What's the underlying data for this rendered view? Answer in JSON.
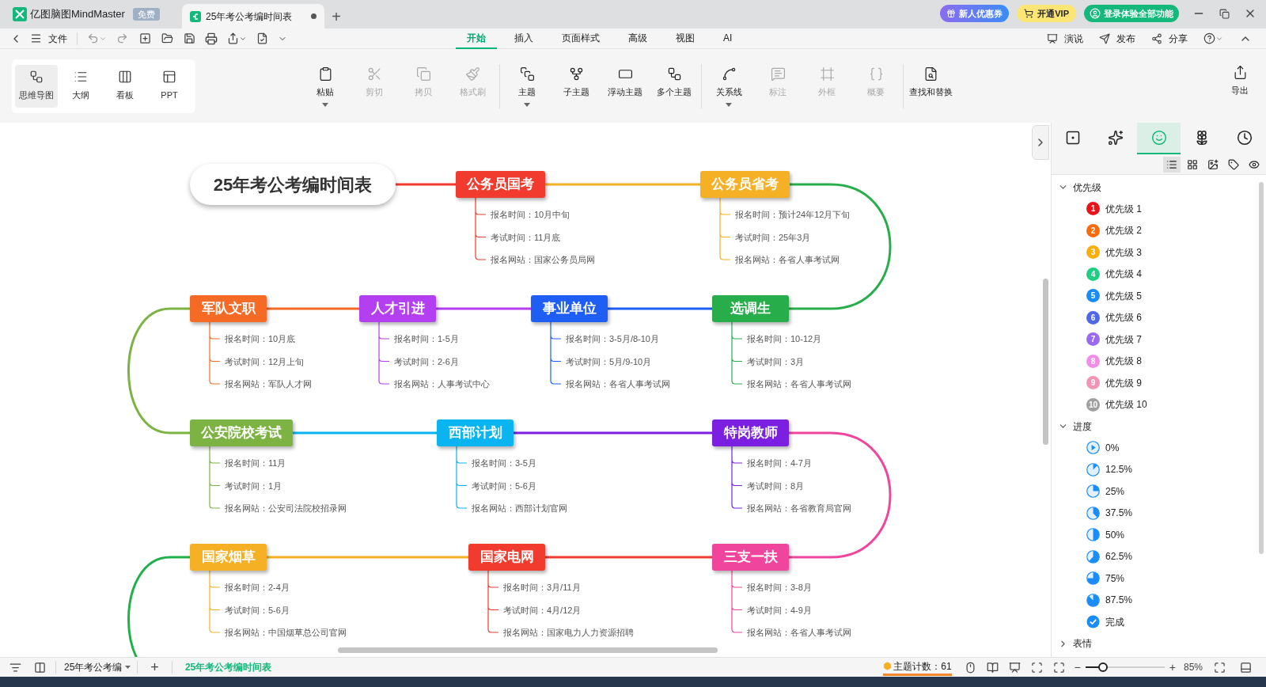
{
  "title_bar": {
    "app_tab": {
      "name": "亿图脑图MindMaster",
      "badge": "免费"
    },
    "document_tab": {
      "title": "25年考公考编时间表",
      "unsaved": true,
      "selected": true
    },
    "new_tab": "+",
    "promo_buttons": [
      "新人优惠券",
      "开通VIP",
      "登录体验全部功能"
    ]
  },
  "toolbar": {
    "file_menu": "文件",
    "menu_tabs": [
      {
        "label": "开始",
        "selected": true
      },
      {
        "label": "插入",
        "selected": false
      },
      {
        "label": "页面样式",
        "selected": false
      },
      {
        "label": "高级",
        "selected": false
      },
      {
        "label": "视图",
        "selected": false
      },
      {
        "label": "AI",
        "selected": false
      }
    ],
    "right_actions": [
      "演说",
      "发布",
      "分享"
    ]
  },
  "ribbon": {
    "views": [
      {
        "label": "思维导图",
        "selected": true
      },
      {
        "label": "大纲",
        "selected": false
      },
      {
        "label": "看板",
        "selected": false
      },
      {
        "label": "PPT",
        "selected": false
      }
    ],
    "groups": [
      [
        {
          "label": "粘贴",
          "disabled": false,
          "dropdown": true
        },
        {
          "label": "剪切",
          "disabled": true,
          "dropdown": false
        },
        {
          "label": "拷贝",
          "disabled": true,
          "dropdown": false
        },
        {
          "label": "格式刷",
          "disabled": true,
          "dropdown": false
        }
      ],
      [
        {
          "label": "主题",
          "disabled": false,
          "dropdown": true
        },
        {
          "label": "子主题",
          "disabled": false,
          "dropdown": false
        },
        {
          "label": "浮动主题",
          "disabled": false,
          "dropdown": false
        },
        {
          "label": "多个主题",
          "disabled": false,
          "dropdown": false
        }
      ],
      [
        {
          "label": "关系线",
          "disabled": false,
          "dropdown": true
        },
        {
          "label": "标注",
          "disabled": true,
          "dropdown": false
        },
        {
          "label": "外框",
          "disabled": true,
          "dropdown": false
        },
        {
          "label": "概要",
          "disabled": true,
          "dropdown": false
        }
      ],
      [
        {
          "label": "查找和替换",
          "disabled": false,
          "dropdown": false
        }
      ]
    ],
    "export": "导出"
  },
  "mind_map": {
    "root": "25年考公考编时间表",
    "topics": [
      {
        "title": "公务员国考",
        "color": "#f03b2e",
        "details": [
          "报名时间：10月中旬",
          "考试时间：11月底",
          "报名网站：国家公务员局网"
        ]
      },
      {
        "title": "公务员省考",
        "color": "#f5b025",
        "details": [
          "报名时间：预计24年12月下旬",
          "考试时间：25年3月",
          "报名网站：各省人事考试网"
        ]
      },
      {
        "title": "军队文职",
        "color": "#f56a25",
        "details": [
          "报名时间：10月底",
          "考试时间：12月上旬",
          "报名网站：军队人才网"
        ]
      },
      {
        "title": "人才引进",
        "color": "#b43ff0",
        "details": [
          "报名时间：1-5月",
          "考试时间：2-6月",
          "报名网站：人事考试中心"
        ]
      },
      {
        "title": "事业单位",
        "color": "#1e5ef5",
        "details": [
          "报名时间：3-5月/8-10月",
          "考试时间：5月/9-10月",
          "报名网站：各省人事考试网"
        ]
      },
      {
        "title": "选调生",
        "color": "#27ae4a",
        "details": [
          "报名时间：10-12月",
          "考试时间：3月",
          "报名网站：各省人事考试网"
        ]
      },
      {
        "title": "公安院校考试",
        "color": "#7cb342",
        "details": [
          "报名时间：11月",
          "考试时间：1月",
          "报名网站：公安司法院校招录网"
        ]
      },
      {
        "title": "西部计划",
        "color": "#0ab4f0",
        "details": [
          "报名时间：3-5月",
          "考试时间：5-6月",
          "报名网站：西部计划官网"
        ]
      },
      {
        "title": "特岗教师",
        "color": "#7b1fe0",
        "details": [
          "报名时间：4-7月",
          "考试时间：8月",
          "报名网站：各省教育局官网"
        ]
      },
      {
        "title": "国家烟草",
        "color": "#f5b025",
        "details": [
          "报名时间：2-4月",
          "考试时间：5-6月",
          "报名网站：中国烟草总公司官网"
        ]
      },
      {
        "title": "国家电网",
        "color": "#f03b2e",
        "details": [
          "报名时间：3月/11月",
          "考试时间：4月/12月",
          "报名网站：国家电力人力资源招聘"
        ]
      },
      {
        "title": "三支一扶",
        "color": "#f0459c",
        "details": [
          "报名时间：3-8月",
          "考试时间：4-9月",
          "报名网站：各省人事考试网"
        ]
      }
    ]
  },
  "side_panel": {
    "tabs": [
      {
        "selected": false
      },
      {
        "selected": false
      },
      {
        "selected": true
      },
      {
        "selected": false
      },
      {
        "selected": false
      }
    ],
    "view_modes": [
      {
        "selected": true
      },
      {
        "selected": false
      },
      {
        "selected": false
      },
      {
        "selected": false
      },
      {
        "selected": false
      }
    ],
    "sections": [
      {
        "title": "优先级",
        "kind": "priority",
        "expanded": true,
        "items": [
          {
            "badge": "1",
            "label": "优先级 1",
            "color": "#e8141b"
          },
          {
            "badge": "2",
            "label": "优先级 2",
            "color": "#f76b0e"
          },
          {
            "badge": "3",
            "label": "优先级 3",
            "color": "#fbae0c"
          },
          {
            "badge": "4",
            "label": "优先级 4",
            "color": "#1ecf82"
          },
          {
            "badge": "5",
            "label": "优先级 5",
            "color": "#1a8cf5"
          },
          {
            "badge": "6",
            "label": "优先级 6",
            "color": "#4f68e8"
          },
          {
            "badge": "7",
            "label": "优先级 7",
            "color": "#9b6bef"
          },
          {
            "badge": "8",
            "label": "优先级 8",
            "color": "#f08de8"
          },
          {
            "badge": "9",
            "label": "优先级 9",
            "color": "#f096b4"
          },
          {
            "badge": "10",
            "label": "优先级 10",
            "color": "#a0a0a0"
          }
        ]
      },
      {
        "title": "进度",
        "kind": "progress",
        "expanded": true,
        "items": [
          {
            "label": "0%",
            "kind": "start"
          },
          {
            "label": "12.5%",
            "kind": "one_eighth"
          },
          {
            "label": "25%",
            "kind": "quarter"
          },
          {
            "label": "37.5%",
            "kind": "three_eighths"
          },
          {
            "label": "50%",
            "kind": "half"
          },
          {
            "label": "62.5%",
            "kind": "five_eighths"
          },
          {
            "label": "75%",
            "kind": "three_quarters"
          },
          {
            "label": "87.5%",
            "kind": "seven_eighths"
          },
          {
            "label": "完成",
            "kind": "done"
          }
        ]
      },
      {
        "title": "表情",
        "expanded": false
      }
    ]
  },
  "status_bar": {
    "sheet_menu": "25年考公考编",
    "add_sheet": "+",
    "sheets": [
      {
        "label": "25年考公考编时间表",
        "selected": true
      }
    ],
    "topic_count": "主题计数：61",
    "zoom": {
      "minus": "−",
      "plus": "+",
      "level": 0.22,
      "reading": "85%"
    }
  }
}
